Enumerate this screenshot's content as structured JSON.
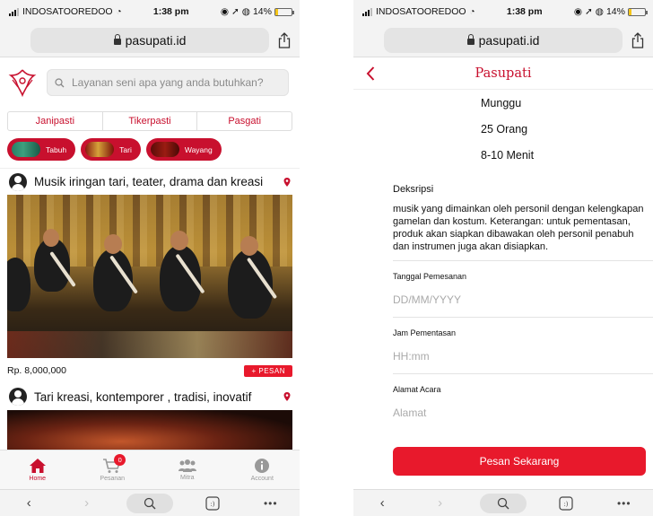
{
  "status": {
    "carrier": "INDOSATOOREDOO",
    "time": "1:38 pm",
    "battery": "14%",
    "battery_level": 0.14
  },
  "browser": {
    "domain": "pasupati.id"
  },
  "home": {
    "search_placeholder": "Layanan seni apa yang anda butuhkan?",
    "tabs": [
      "Janipasti",
      "Tikerpasti",
      "Pasgati"
    ],
    "categories": [
      "Tabuh",
      "Tari",
      "Wayang"
    ],
    "post1": {
      "title": "Musik iringan tari, teater, drama dan kreasi",
      "price": "Rp. 8,000,000",
      "order_label": "+ PESAN"
    },
    "post2": {
      "title": "Tari kreasi, kontemporer , tradisi, inovatif"
    },
    "nav": [
      {
        "label": "Home",
        "icon": "home-icon",
        "active": true
      },
      {
        "label": "Pesanan",
        "icon": "cart-icon",
        "badge": "0"
      },
      {
        "label": "Mitra",
        "icon": "people-icon"
      },
      {
        "label": "Account",
        "icon": "info-icon"
      }
    ]
  },
  "detail": {
    "title": "Pasupati",
    "location": "Munggu",
    "people": "25 Orang",
    "duration": "8-10 Menit",
    "description_label": "Deksripsi",
    "description": "musik yang dimainkan oleh personil dengan kelengkapan gamelan dan kostum. Keterangan: untuk pementasan, produk akan siapkan dibawakan oleh personil penabuh dan instrumen juga akan disiapkan.",
    "fields": [
      {
        "label": "Tanggal Pemesanan",
        "placeholder": "DD/MM/YYYY"
      },
      {
        "label": "Jam Pementasan",
        "placeholder": "HH:mm"
      },
      {
        "label": "Alamat Acara",
        "placeholder": "Alamat"
      }
    ],
    "submit_label": "Pesan Sekarang"
  },
  "colors": {
    "brand": "#c8102e",
    "button": "#e8192c"
  }
}
